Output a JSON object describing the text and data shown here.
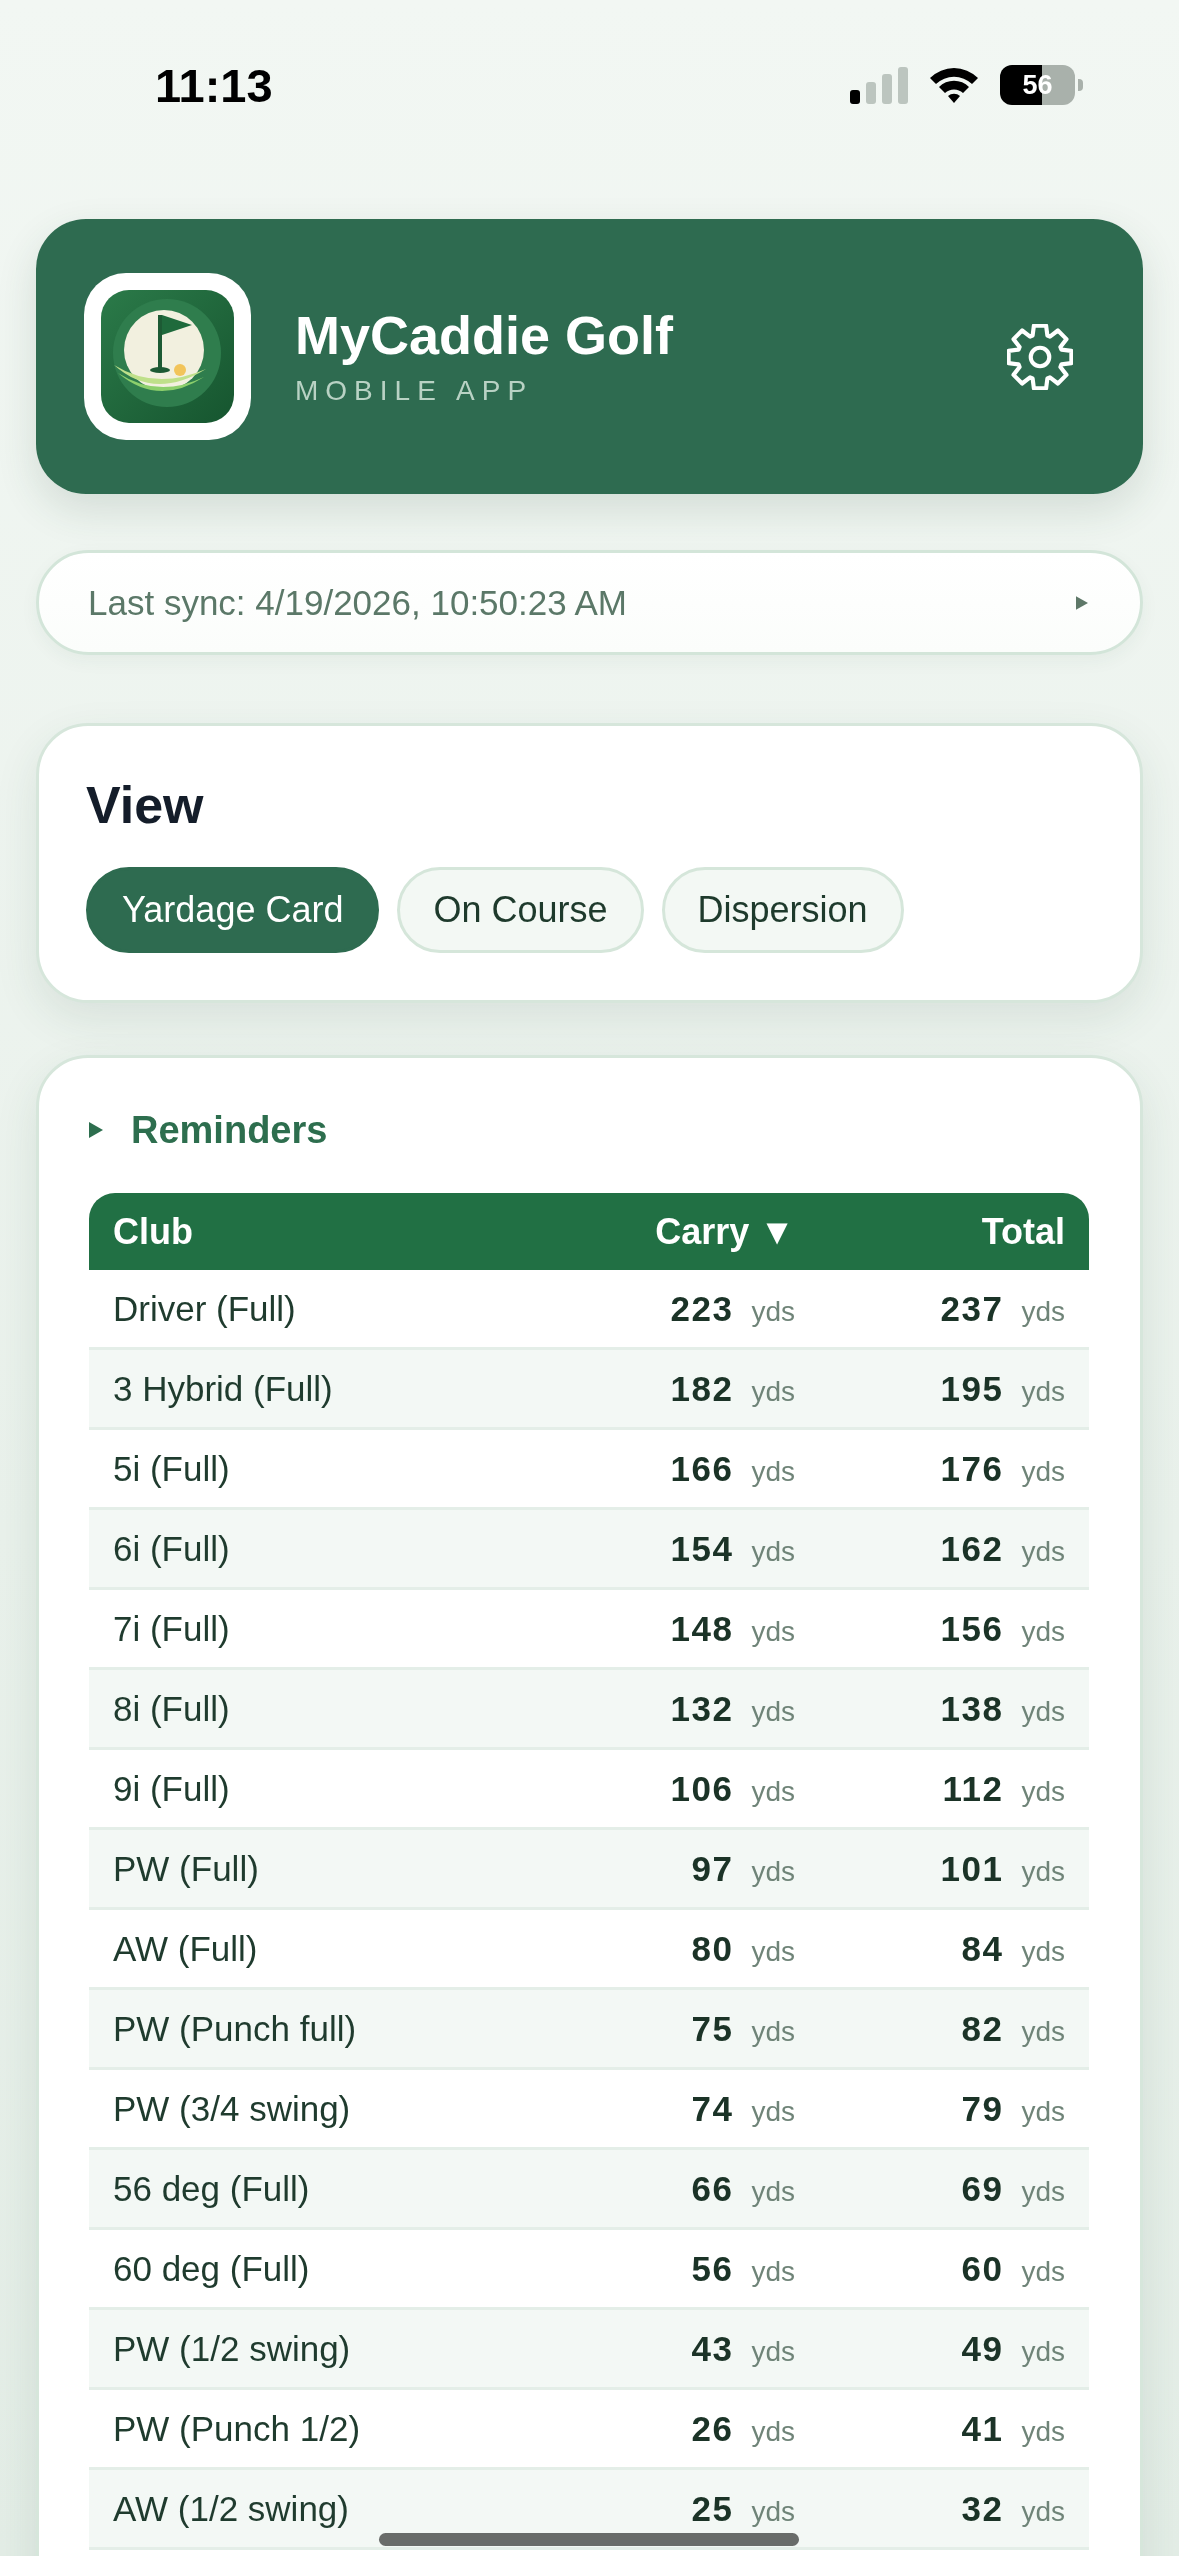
{
  "status_bar": {
    "time": "11:13",
    "battery": "56"
  },
  "header": {
    "title": "MyCaddie Golf",
    "subtitle": "MOBILE APP"
  },
  "sync": {
    "text": "Last sync: 4/19/2026, 10:50:23 AM",
    "expanded": false
  },
  "view": {
    "title": "View",
    "tabs": [
      {
        "label": "Yardage Card",
        "selected": true
      },
      {
        "label": "On Course",
        "selected": false
      },
      {
        "label": "Dispersion",
        "selected": false
      }
    ]
  },
  "reminders": {
    "label": "Reminders",
    "expanded": false
  },
  "table": {
    "columns": [
      "Club",
      "Carry ▼",
      "Total"
    ],
    "rows": [
      {
        "club": "Driver (Full)",
        "carry": "223",
        "carry_unit": "yds",
        "total": "237",
        "total_unit": "yds"
      },
      {
        "club": "3 Hybrid (Full)",
        "carry": "182",
        "carry_unit": "yds",
        "total": "195",
        "total_unit": "yds"
      },
      {
        "club": "5i (Full)",
        "carry": "166",
        "carry_unit": "yds",
        "total": "176",
        "total_unit": "yds"
      },
      {
        "club": "6i (Full)",
        "carry": "154",
        "carry_unit": "yds",
        "total": "162",
        "total_unit": "yds"
      },
      {
        "club": "7i (Full)",
        "carry": "148",
        "carry_unit": "yds",
        "total": "156",
        "total_unit": "yds"
      },
      {
        "club": "8i (Full)",
        "carry": "132",
        "carry_unit": "yds",
        "total": "138",
        "total_unit": "yds"
      },
      {
        "club": "9i (Full)",
        "carry": "106",
        "carry_unit": "yds",
        "total": "112",
        "total_unit": "yds"
      },
      {
        "club": "PW (Full)",
        "carry": "97",
        "carry_unit": "yds",
        "total": "101",
        "total_unit": "yds"
      },
      {
        "club": "AW (Full)",
        "carry": "80",
        "carry_unit": "yds",
        "total": "84",
        "total_unit": "yds"
      },
      {
        "club": "PW (Punch full)",
        "carry": "75",
        "carry_unit": "yds",
        "total": "82",
        "total_unit": "yds"
      },
      {
        "club": "PW (3/4 swing)",
        "carry": "74",
        "carry_unit": "yds",
        "total": "79",
        "total_unit": "yds"
      },
      {
        "club": "56 deg (Full)",
        "carry": "66",
        "carry_unit": "yds",
        "total": "69",
        "total_unit": "yds"
      },
      {
        "club": "60 deg (Full)",
        "carry": "56",
        "carry_unit": "yds",
        "total": "60",
        "total_unit": "yds"
      },
      {
        "club": "PW (1/2 swing)",
        "carry": "43",
        "carry_unit": "yds",
        "total": "49",
        "total_unit": "yds"
      },
      {
        "club": "PW (Punch 1/2)",
        "carry": "26",
        "carry_unit": "yds",
        "total": "41",
        "total_unit": "yds"
      },
      {
        "club": "AW (1/2 swing)",
        "carry": "25",
        "carry_unit": "yds",
        "total": "32",
        "total_unit": "yds"
      }
    ]
  }
}
